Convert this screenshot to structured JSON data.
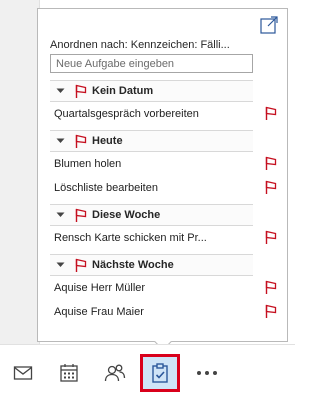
{
  "popup": {
    "arrange_label": "Anordnen nach: Kennzeichen: Fälli...",
    "new_task_placeholder": "Neue Aufgabe eingeben",
    "groups": [
      {
        "title": "Kein Datum",
        "tasks": [
          "Quartalsgespräch vorbereiten"
        ]
      },
      {
        "title": "Heute",
        "tasks": [
          "Blumen holen",
          "Löschliste bearbeiten"
        ]
      },
      {
        "title": "Diese Woche",
        "tasks": [
          "Rensch Karte schicken mit Pr..."
        ]
      },
      {
        "title": "Nächste Woche",
        "tasks": [
          "Aquise Herr Müller",
          "Aquise Frau Maier"
        ]
      }
    ]
  },
  "nav": {
    "items": [
      "mail-icon",
      "calendar-icon",
      "people-icon",
      "tasks-icon",
      "more-icon"
    ],
    "active": "tasks-icon"
  },
  "colors": {
    "flag": "#c50f1f",
    "active_bg": "#cfe4f7",
    "highlight_box": "#d9001b",
    "icon": "#444444"
  }
}
